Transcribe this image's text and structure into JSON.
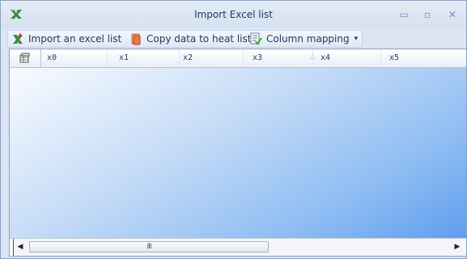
{
  "window": {
    "title": "Import Excel list",
    "controls": {
      "minimize": "▭",
      "maximize": "▫",
      "close": "✕"
    }
  },
  "toolbar": {
    "import_label": "Import an excel list",
    "copy_label": "Copy data to heat list",
    "mapping_label": "Column mapping",
    "mapping_arrow": "▾"
  },
  "grid": {
    "columns": [
      "x0",
      "x1",
      "x2",
      "x3",
      "x4",
      "x5"
    ],
    "sort_glyph": "△"
  },
  "scrollbar": {
    "left_arrow": "◀",
    "right_arrow": "▶",
    "grip": "III"
  },
  "colors": {
    "accent": "#1e395b",
    "background_top": "#f8fbff",
    "background_bottom": "#5f9eee"
  }
}
